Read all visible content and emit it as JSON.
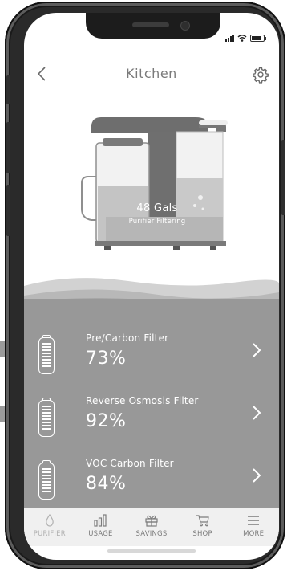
{
  "header": {
    "title": "Kitchen"
  },
  "device": {
    "gallons": "48 Gals",
    "status": "Purifier Filtering"
  },
  "filters": [
    {
      "name": "Pre/Carbon Filter",
      "percent": "73%",
      "icon": "filter-cartridge-icon"
    },
    {
      "name": "Reverse Osmosis Filter",
      "percent": "92%",
      "icon": "filter-cartridge-icon"
    },
    {
      "name": "VOC Carbon Filter",
      "percent": "84%",
      "icon": "filter-cartridge-icon"
    }
  ],
  "nav": [
    {
      "label": "PURIFIER",
      "icon": "water-drop-icon"
    },
    {
      "label": "USAGE",
      "icon": "bar-chart-icon"
    },
    {
      "label": "SAVINGS",
      "icon": "gift-icon"
    },
    {
      "label": "SHOP",
      "icon": "cart-icon"
    },
    {
      "label": "MORE",
      "icon": "menu-icon"
    }
  ],
  "colors": {
    "panel": "#989898",
    "nav_background": "#f0f0f0",
    "text_on_panel": "#ffffff",
    "header_text": "#7a7a7a"
  }
}
